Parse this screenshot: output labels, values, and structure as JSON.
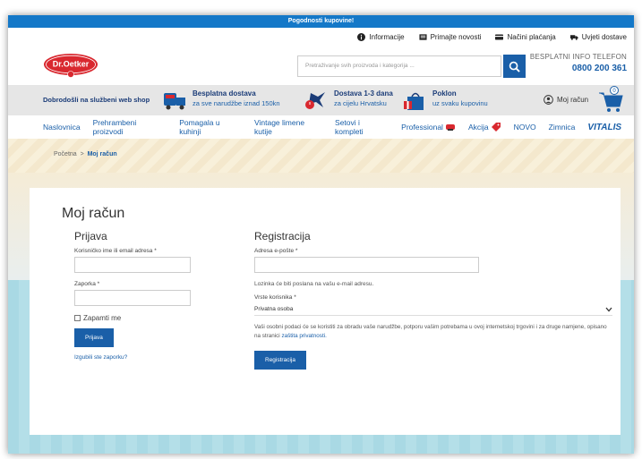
{
  "topbar": {
    "promo": "Pogodnosti kupovine!"
  },
  "utility": {
    "items": [
      {
        "label": "Informacije",
        "icon": "info-icon"
      },
      {
        "label": "Primajte novosti",
        "icon": "newsletter-icon"
      },
      {
        "label": "Načini plaćanja",
        "icon": "card-icon"
      },
      {
        "label": "Uvjeti dostave",
        "icon": "truck-icon"
      }
    ]
  },
  "header": {
    "logo": "Dr.Oetker",
    "search_placeholder": "Pretraživanje svih proizvoda i kategorija ...",
    "info_label": "BESPLATNI INFO TELEFON",
    "info_phone": "0800 200 361"
  },
  "benefits": {
    "welcome": "Dobrodošli na službeni web shop",
    "items": [
      {
        "title": "Besplatna dostava",
        "subtitle": "za sve narudžbe iznad 150kn"
      },
      {
        "title": "Dostava 1-3 dana",
        "subtitle": "za cijelu Hrvatsku"
      },
      {
        "title": "Poklon",
        "subtitle": "uz svaku kupovinu"
      }
    ],
    "account": "Moj račun",
    "cart_count": "0"
  },
  "nav": {
    "items": [
      "Naslovnica",
      "Prehrambeni proizvodi",
      "Pomagala u kuhinji",
      "Vintage limene kutije",
      "Setovi i kompleti",
      "Professional",
      "Akcija",
      "NOVO",
      "Zimnica",
      "VITALIS"
    ]
  },
  "breadcrumb": {
    "home": "Početna",
    "sep": ">",
    "current": "Moj račun"
  },
  "page": {
    "title": "Moj račun",
    "login": {
      "heading": "Prijava",
      "username_label": "Korisničko ime ili email adresa *",
      "password_label": "Zaporka *",
      "remember": "Zapamti me",
      "submit": "Prijava",
      "lost": "Izgubili ste zaporku?"
    },
    "register": {
      "heading": "Registracija",
      "email_label": "Adresa e-pošte *",
      "note": "Lozinka će biti poslana na vašu e-mail adresu.",
      "type_label": "Vrste korisnika *",
      "type_value": "Privatna osoba",
      "privacy_text": "Vaši osobni podaci će se koristiti za obradu vaše narudžbe, potporu vašim potrebama u ovoj internetskoj trgovini i za druge namjene, opisano na stranici",
      "privacy_link": "zaštita privatnosti.",
      "submit": "Registracija"
    }
  },
  "colors": {
    "primary": "#1a5fa8",
    "topbar": "#1478c8",
    "logo_red": "#d9282f"
  }
}
